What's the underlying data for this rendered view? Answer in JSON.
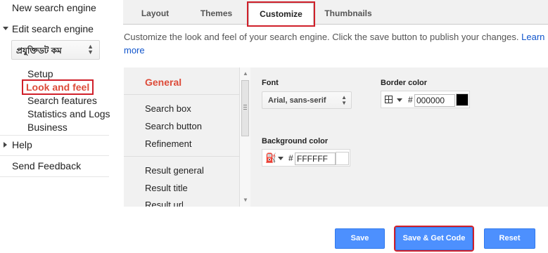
{
  "sidebar": {
    "new_engine": "New search engine",
    "edit_engine": "Edit search engine",
    "engine_select_value": "প্রযুক্তিডট কম",
    "sub_items": [
      "Setup",
      "Look and feel",
      "Search features",
      "Statistics and Logs",
      "Business"
    ],
    "help": "Help",
    "send_feedback": "Send Feedback"
  },
  "tabs": [
    "Layout",
    "Themes",
    "Customize",
    "Thumbnails"
  ],
  "active_tab": "Customize",
  "description": "Customize the look and feel of your search engine. Click the save button to publish your changes.",
  "learn_more_part1": "Learn",
  "learn_more_part2": "more",
  "categories": {
    "general": "General",
    "group1": [
      "Search box",
      "Search button",
      "Refinement"
    ],
    "group2": [
      "Result general",
      "Result title",
      "Result url"
    ]
  },
  "settings": {
    "font_label": "Font",
    "font_value": "Arial, sans-serif",
    "border_color_label": "Border color",
    "border_color_value": "000000",
    "background_color_label": "Background color",
    "background_color_value": "FFFFFF",
    "hash": "#"
  },
  "buttons": {
    "save": "Save",
    "save_get_code": "Save & Get Code",
    "reset": "Reset"
  },
  "colors": {
    "accent_blue": "#4d90fe",
    "highlight_red": "#d0202a",
    "active_category": "#dd4b39",
    "border_swatch": "#000000",
    "background_swatch": "#ffffff"
  }
}
